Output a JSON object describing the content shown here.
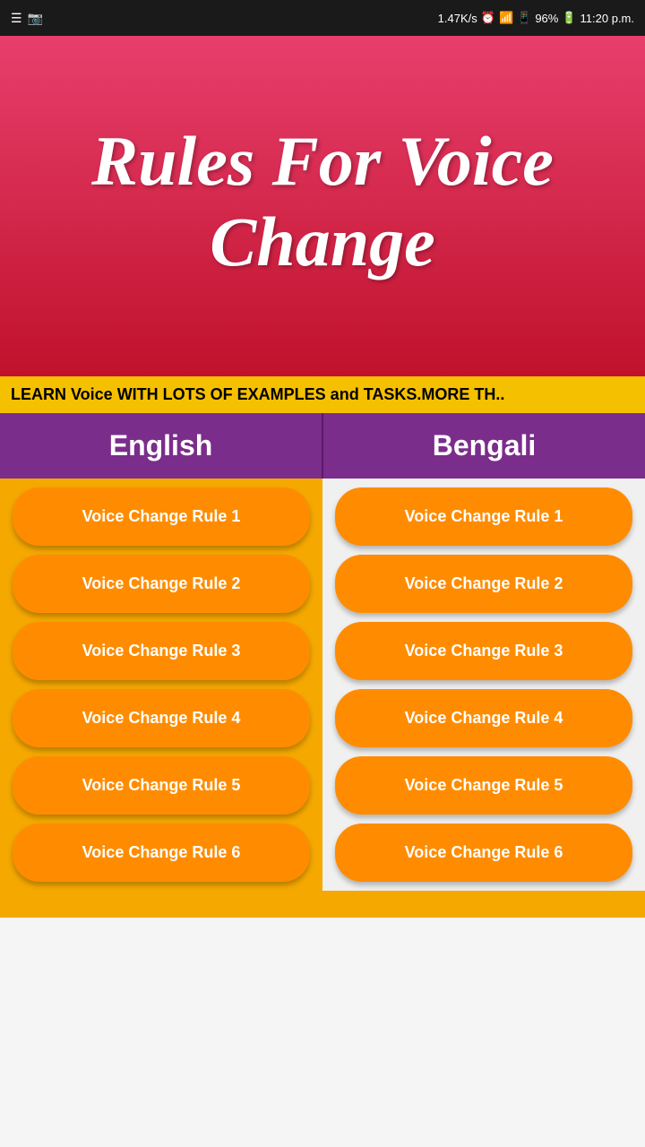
{
  "status": {
    "speed": "1.47K/s",
    "time": "11:20 p.m.",
    "battery": "96%",
    "icons_left": [
      "☰",
      "📷"
    ]
  },
  "header": {
    "title": "Rules For Voice Change"
  },
  "marquee": {
    "text": "LEARN Voice WITH LOTS OF EXAMPLES and TASKS.MORE TH.."
  },
  "columns": {
    "left_label": "English",
    "right_label": "Bengali"
  },
  "rules": [
    {
      "label": "Voice Change Rule 1"
    },
    {
      "label": "Voice Change Rule 2"
    },
    {
      "label": "Voice Change Rule 3"
    },
    {
      "label": "Voice Change Rule 4"
    },
    {
      "label": "Voice Change Rule 5"
    },
    {
      "label": "Voice Change Rule 6"
    }
  ]
}
